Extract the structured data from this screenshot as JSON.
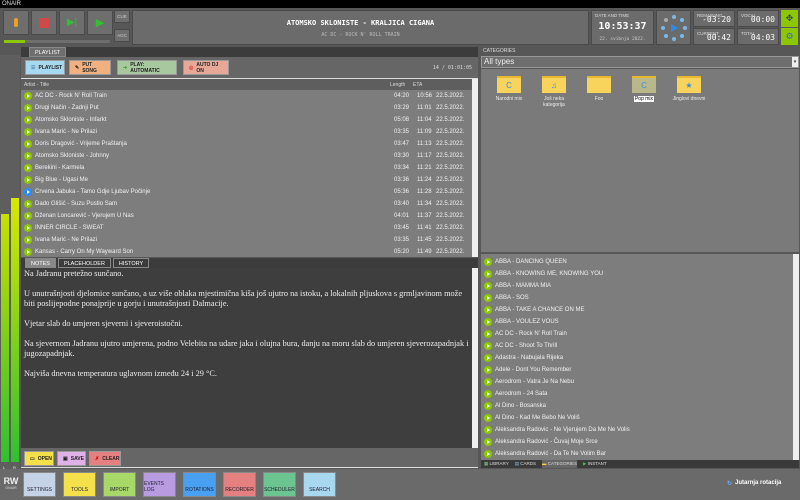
{
  "window": {
    "title": "ONAIR"
  },
  "controls": {
    "cue": "CUE",
    "agc": "AGC",
    "progress": 0.2
  },
  "now_playing": {
    "title": "ATOMSKO SKLONISTE - KRALJICA CIGANA",
    "next": "AC DC - ROCK N' ROLL TRAIN"
  },
  "clock": {
    "label": "DATE AND TIME",
    "time": "10:53:37",
    "date": "22. svibnja 2022."
  },
  "timers": {
    "remaining_label": "REMAINING",
    "remaining": "-03:20",
    "vocal_label": "VOCAL",
    "vocal": "00:00",
    "current_label": "CURRENT",
    "current": "00:42",
    "total_label": "TOTAL",
    "total": "04:03"
  },
  "vu": {
    "left_label": "L",
    "right_label": "R",
    "left_level": 0.62,
    "right_level": 0.66
  },
  "playlist": {
    "tab": "PLAYLIST",
    "buttons": [
      "PLAYLIST",
      "PUT SONG",
      "PLAY: AUTOMATIC",
      "AUTO DJ ON"
    ],
    "summary": "14 / 01:01:05",
    "columns": [
      "Artist - Title",
      "Length",
      "ETA"
    ],
    "rows": [
      [
        "AC DC - Rock N' Roll Train",
        "04:20",
        "10:56",
        "22.5.2022."
      ],
      [
        "Drugi Način - Zadnji Put",
        "03:29",
        "11:01",
        "22.5.2022."
      ],
      [
        "Atomsko Skloniste - Infarkt",
        "05:08",
        "11:04",
        "22.5.2022."
      ],
      [
        "Ivana Marić - Ne Prilazi",
        "03:35",
        "11:09",
        "22.5.2022."
      ],
      [
        "Doris Dragović - Vrijeme Praštanja",
        "03:47",
        "11:13",
        "22.5.2022."
      ],
      [
        "Atomsko Skloniste - Johnny",
        "03:30",
        "11:17",
        "22.5.2022."
      ],
      [
        "Berekini - Karmela",
        "03:34",
        "11:21",
        "22.5.2022."
      ],
      [
        "Big Blue - Ugasi Me",
        "03:36",
        "11:24",
        "22.5.2022."
      ],
      [
        "Crvena Jabuka - Tamo Gdje Ljubav Počinje",
        "05:36",
        "11:28",
        "22.5.2022."
      ],
      [
        "Dado Glišić - Suzu Pustio Sam",
        "03:40",
        "11:34",
        "22.5.2022."
      ],
      [
        "Dženan Loncarević - Vjerujem U Nas",
        "04:01",
        "11:37",
        "22.5.2022."
      ],
      [
        "INNER CIRCLE - SWEAT",
        "03:45",
        "11:41",
        "22.5.2022."
      ],
      [
        "Ivana Marić - Ne Prilazi",
        "03:35",
        "11:45",
        "22.5.2022."
      ],
      [
        "Kansas - Carry On My Wayward Son",
        "05:20",
        "11:49",
        "22.5.2022."
      ]
    ]
  },
  "notes": {
    "tabs": [
      "NOTES",
      "PLACEHOLDER",
      "HISTORY"
    ],
    "paragraphs": [
      "Na Jadranu pretežno sunčano.",
      "U unutrašnjosti djelomice sunčano, a uz više oblaka mjestimična kiša još ujutro na istoku, a lokalnih pljuskova s grmljavinom može biti poslijepodne ponajprije u gorju i unutrašnjosti Dalmacije.",
      "Vjetar slab do umjeren sjeverni i sjeveroistočni.",
      "Na sjevernom Jadranu ujutro umjerena, podno Velebita na udare jaka i olujna bura, danju na moru slab do umjeren sjeverozapadnjak i jugozapadnjak.",
      "Najviša dnevna temperatura uglavnom između 24 i 29 °C."
    ],
    "buttons": [
      "OPEN",
      "SAVE",
      "CLEAR"
    ]
  },
  "categories": {
    "label": "CATEGORIES",
    "select": "All types",
    "folders": [
      {
        "name": "Narodni mix",
        "icon": "C"
      },
      {
        "name": "Još neka kategorija",
        "icon": "♫"
      },
      {
        "name": "Foo",
        "icon": ""
      },
      {
        "name": "Pop mix",
        "icon": "C"
      },
      {
        "name": "Jinglovi dnevni",
        "icon": "★"
      }
    ],
    "selected": "Pop mix"
  },
  "library": {
    "items": [
      "ABBA - DANCING QUEEN",
      "ABBA - KNOWING ME, KNOWING YOU",
      "ABBA - MAMMA MIA",
      "ABBA - SOS",
      "ABBA - TAKE A CHANCE ON ME",
      "ABBA - VOULEZ VOUS",
      "AC DC - Rock N' Roll Train",
      "AC DC - Shoot To Thrill",
      "Adastra - Nabujala Rijeka",
      "Adele - Dont You Remember",
      "Aerodrom - Vatra Je Na Nebu",
      "Aerodrom - 24 Sata",
      "Al Dino - Bosanska",
      "Al Dino - Kad Me Bebo Ne Voliš",
      "Aleksandra Radovic - Ne Vjerujem Da Me Ne Volis",
      "Aleksandra Radović - Čuvaj Moje Srce",
      "Aleksandra Radović - Da Te Ne Volim Bar"
    ],
    "tabs": [
      "LIBRARY",
      "CARDS",
      "CATEGORIES",
      "INSTANT"
    ]
  },
  "toolbar": {
    "logo": "RW",
    "logo_sub": "ONAIR",
    "buttons": [
      "SETTINGS",
      "TOOLS",
      "IMPORT",
      "EVENTS LOG",
      "ROTATIONS",
      "RECORDER",
      "SCHEDULER",
      "SEARCH"
    ],
    "colors": [
      "#c5d3e6",
      "#f3e04a",
      "#a8d868",
      "#b89be0",
      "#4aa0f0",
      "#e48080",
      "#6cc490",
      "#a8d8f0"
    ]
  },
  "rotation": {
    "label": "Jutarnja rotacija"
  }
}
